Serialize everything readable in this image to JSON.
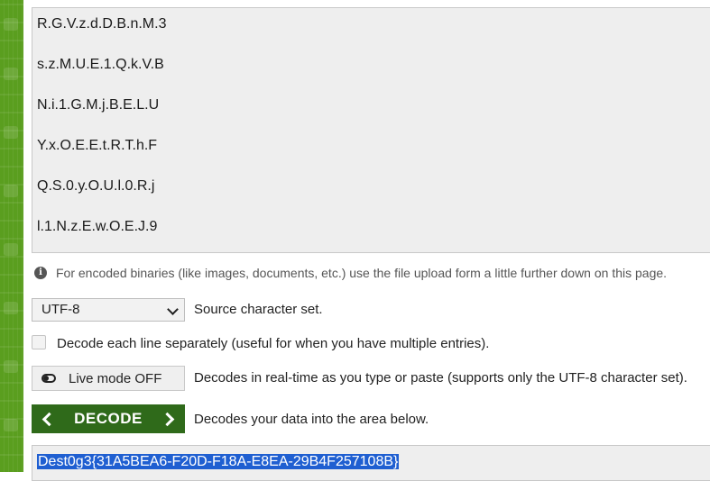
{
  "input": {
    "lines": [
      "R.G.V.z.d.D.B.n.M.3",
      "s.z.M.U.E.1.Q.k.V.B",
      "N.i.1.G.M.j.B.E.L.U",
      "Y.x.O.E.E.t.R.T.h.F",
      "Q.S.0.y.O.U.l.0.R.j",
      "l.1.N.z.E.w.O.E.J.9"
    ]
  },
  "info_text": "For encoded binaries (like images, documents, etc.) use the file upload form a little further down on this page.",
  "charset": {
    "selected": "UTF-8",
    "label": "Source character set."
  },
  "each_line": {
    "label": "Decode each line separately (useful for when you have multiple entries)."
  },
  "live_mode": {
    "button_label": "Live mode OFF",
    "description": "Decodes in real-time as you type or paste (supports only the UTF-8 character set)."
  },
  "decode": {
    "button_label": "DECODE",
    "description": "Decodes your data into the area below."
  },
  "output": {
    "text": "Dest0g3{31A5BEA6-F20D-F18A-E8EA-29B4F257108B}"
  },
  "colors": {
    "sidebar": "#5a9e1f",
    "decode_button": "#2f6a1a",
    "selection": "#1f5fd1"
  }
}
